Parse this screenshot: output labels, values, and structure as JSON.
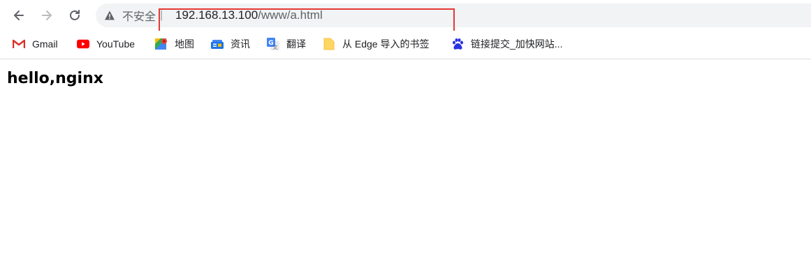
{
  "browser": {
    "security_label": "不安全",
    "security_separator": "|",
    "url_host": "192.168.13.100",
    "url_path": "/www/a.html"
  },
  "bookmarks": [
    {
      "label": "Gmail",
      "icon": "gmail-icon"
    },
    {
      "label": "YouTube",
      "icon": "youtube-icon"
    },
    {
      "label": "地图",
      "icon": "maps-icon"
    },
    {
      "label": "资讯",
      "icon": "news-icon"
    },
    {
      "label": "翻译",
      "icon": "translate-icon"
    },
    {
      "label": "从 Edge 导入的书签",
      "icon": "folder-icon"
    },
    {
      "label": "链接提交_加快网站...",
      "icon": "baidu-paw-icon"
    }
  ],
  "page": {
    "heading": "hello,nginx"
  },
  "colors": {
    "highlight": "#e53935",
    "omnibox_bg": "#f1f3f4"
  }
}
